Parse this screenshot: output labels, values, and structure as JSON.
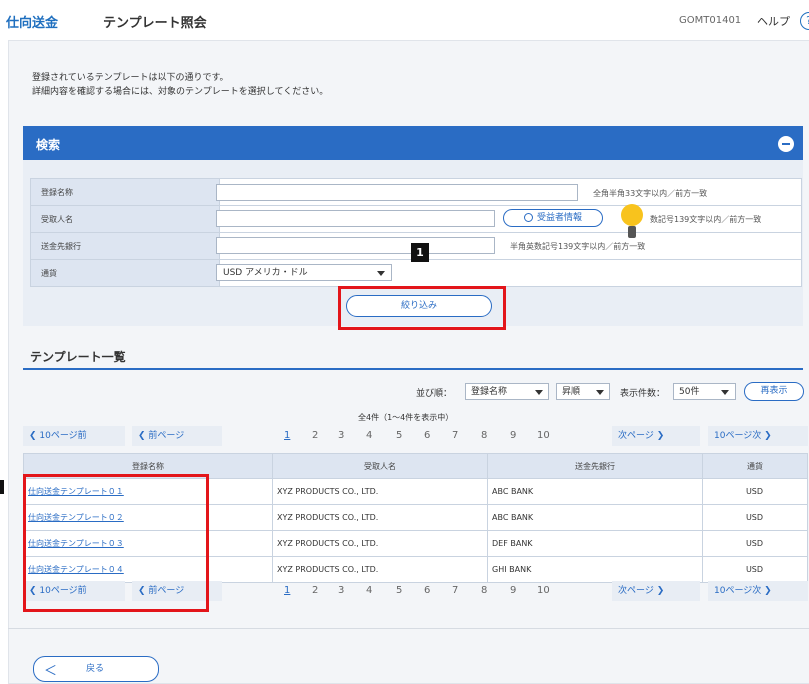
{
  "header": {
    "category": "仕向送金",
    "title": "テンプレート照会",
    "screen_code": "GOMT01401",
    "help_label": "ヘルプ",
    "help_glyph": "?"
  },
  "intro": {
    "line1": "登録されているテンプレートは以下の通りです。",
    "line2": "詳細内容を確認する場合には、対象のテンプレートを選択してください。"
  },
  "search": {
    "title": "検索",
    "fields": [
      {
        "label": "登録名称",
        "hint": "全角半角33文字以内／前方一致"
      },
      {
        "label": "受取人名",
        "hint": "数記号139文字以内／前方一致",
        "button": "受益者情報"
      },
      {
        "label": "送金先銀行",
        "hint": "半角英数記号139文字以内／前方一致"
      },
      {
        "label": "通貨",
        "select_value": "USD アメリカ・ドル"
      }
    ],
    "filter_button": "絞り込み",
    "callout_number": "1"
  },
  "list": {
    "section_title": "テンプレート一覧",
    "sort_label": "並び順：",
    "sort_field": "登録名称",
    "sort_order": "昇順",
    "count_label": "表示件数：",
    "count_value": "50件",
    "redisplay_button": "再表示",
    "summary": "全4件（1～4件を表示中）",
    "pager": {
      "prev10": "10ページ前",
      "prev": "前ページ",
      "next": "次ページ",
      "next10": "10ページ次",
      "pages": [
        "1",
        "2",
        "3",
        "4",
        "5",
        "6",
        "7",
        "8",
        "9",
        "10"
      ],
      "current": "1"
    },
    "columns": [
      "登録名称",
      "受取人名",
      "送金先銀行",
      "通貨"
    ],
    "rows": [
      [
        "仕向送金テンプレート０１",
        "XYZ PRODUCTS CO., LTD.",
        "ABC BANK",
        "USD"
      ],
      [
        "仕向送金テンプレート０２",
        "XYZ PRODUCTS CO., LTD.",
        "ABC BANK",
        "USD"
      ],
      [
        "仕向送金テンプレート０３",
        "XYZ PRODUCTS CO., LTD.",
        "DEF BANK",
        "USD"
      ],
      [
        "仕向送金テンプレート０４",
        "XYZ PRODUCTS CO., LTD.",
        "GHI BANK",
        "USD"
      ]
    ]
  },
  "footer": {
    "back_label": "戻る",
    "back_glyph": "＜"
  }
}
